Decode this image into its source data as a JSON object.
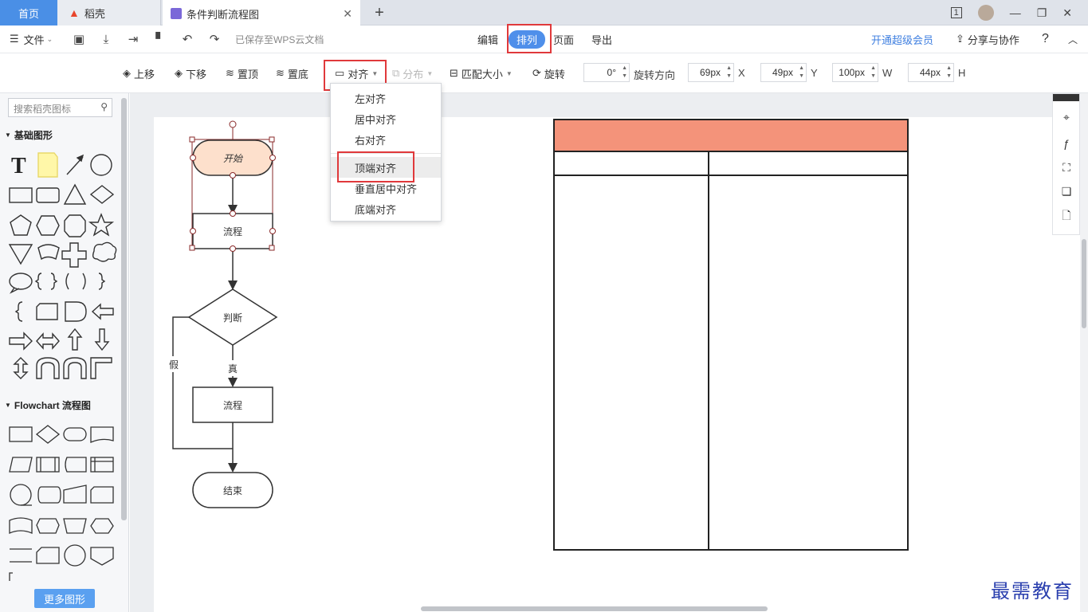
{
  "tabs": {
    "home": "首页",
    "daoke": "稻壳",
    "doc": "条件判断流程图",
    "page_count": "1"
  },
  "menubar": {
    "file": "文件",
    "saved_status": "已保存至WPS云文档",
    "edit": "编辑",
    "arrange": "排列",
    "page": "页面",
    "export": "导出",
    "vip": "开通超级会员",
    "share": "分享与协作",
    "help": "?"
  },
  "toolbar": {
    "move_up": "上移",
    "move_down": "下移",
    "to_top": "置顶",
    "to_bottom": "置底",
    "align": "对齐",
    "distribute": "分布",
    "match_size": "匹配大小",
    "rotate": "旋转",
    "rotation_value": "0°",
    "rotate_direction": "旋转方向",
    "x_value": "69px",
    "x_label": "X",
    "y_value": "49px",
    "y_label": "Y",
    "w_value": "100px",
    "w_label": "W",
    "h_value": "44px",
    "h_label": "H"
  },
  "align_menu": {
    "items": [
      "左对齐",
      "居中对齐",
      "右对齐",
      "顶端对齐",
      "垂直居中对齐",
      "底端对齐"
    ],
    "highlighted": "顶端对齐"
  },
  "left_panel": {
    "search_placeholder": "搜索稻壳图标",
    "section_basic": "基础图形",
    "section_flowchart": "Flowchart 流程图",
    "more_shapes": "更多图形"
  },
  "diagram": {
    "start": "开始",
    "process1": "流程",
    "decision": "判断",
    "false_label": "假",
    "true_label": "真",
    "process2": "流程",
    "end": "结束"
  },
  "table": {
    "header_color": "#f4937a"
  },
  "watermark": "最需教育",
  "colors": {
    "accent": "#4f8fea",
    "highlight_box": "#e0393b",
    "start_fill": "#fde0cc"
  }
}
